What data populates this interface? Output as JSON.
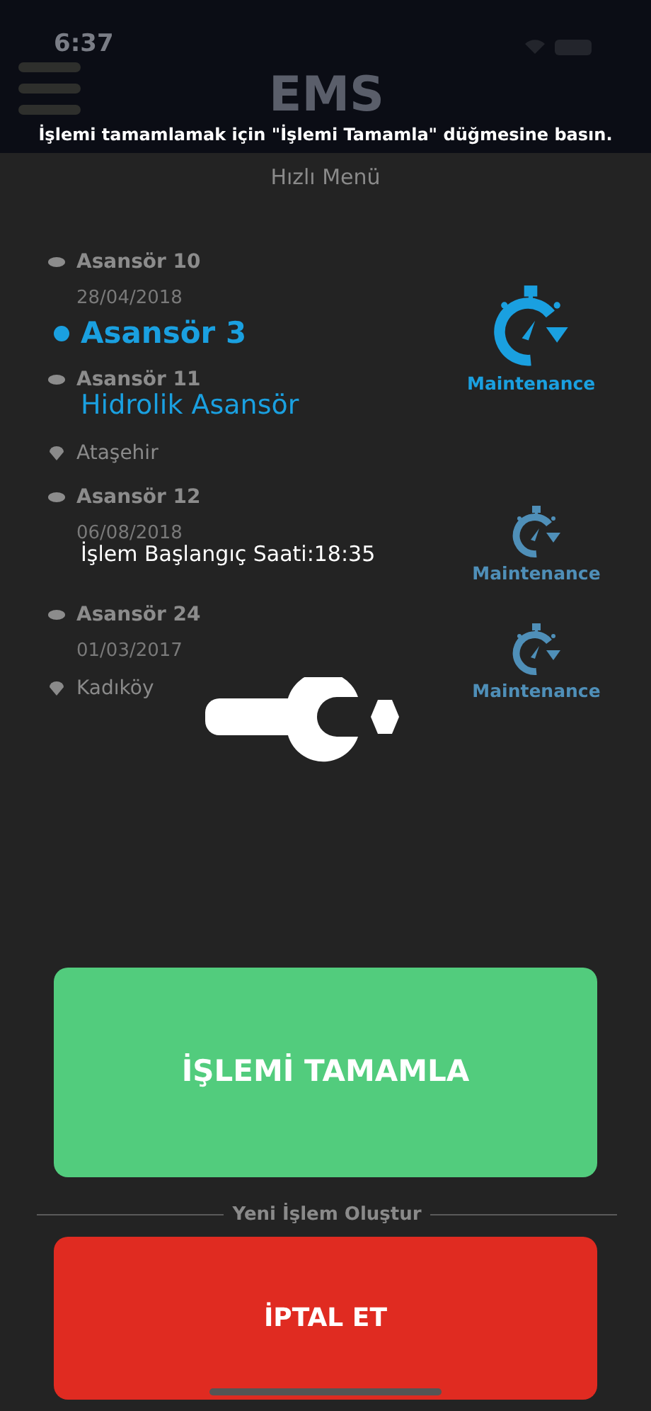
{
  "status_bar": {
    "time": "6:37"
  },
  "header": {
    "title": "EMS"
  },
  "section_title": "Hızlı Menü",
  "elevators": [
    {
      "name": "Asansör 10",
      "date": "28/04/2018"
    },
    {
      "name": "Asansör 11",
      "location": "Ataşehir"
    },
    {
      "name": "Asansör 12",
      "date": "06/08/2018",
      "action": "Maintenance"
    },
    {
      "name": "Asansör 24",
      "date": "01/03/2017",
      "location": "Kadıköy",
      "action": "Maintenance"
    }
  ],
  "divider_label": "Yeni İşlem Oluştur",
  "tutorial": {
    "hint": "İşlemi tamamlamak için \"İşlemi Tamamla\" düğmesine basın.",
    "elevator_name": "Asansör 3",
    "elevator_type": "Hidrolik Asansör",
    "action": "Maintenance",
    "start_time": "İşlem Başlangıç Saati:18:35"
  },
  "buttons": [
    {
      "label": "İŞLEMİ TAMAMLA",
      "kind": "confirm"
    },
    {
      "label": "İPTAL ET",
      "kind": "cancel"
    }
  ]
}
